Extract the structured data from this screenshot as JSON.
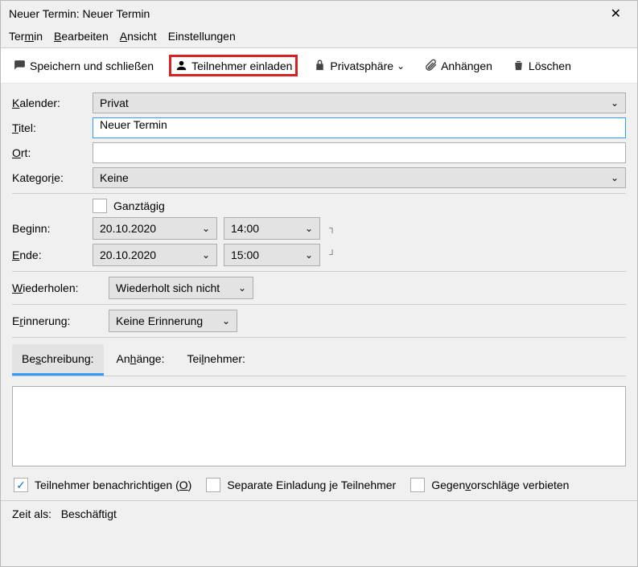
{
  "window": {
    "title": "Neuer Termin: Neuer Termin"
  },
  "menu": {
    "termin": "Termin",
    "bearbeiten": "Bearbeiten",
    "ansicht": "Ansicht",
    "einstellungen": "Einstellungen"
  },
  "toolbar": {
    "save_close": "Speichern und schließen",
    "invite": "Teilnehmer einladen",
    "privacy": "Privatsphäre",
    "attach": "Anhängen",
    "delete": "Löschen"
  },
  "labels": {
    "calendar": "Kalender:",
    "title": "Titel:",
    "location": "Ort:",
    "category": "Kategorie:",
    "allday": "Ganztägig",
    "start": "Beginn:",
    "end": "Ende:",
    "repeat": "Wiederholen:",
    "reminder": "Erinnerung:"
  },
  "values": {
    "calendar": "Privat",
    "title": "Neuer Termin",
    "location": "",
    "category": "Keine",
    "start_date": "20.10.2020",
    "start_time": "14:00",
    "end_date": "20.10.2020",
    "end_time": "15:00",
    "repeat": "Wiederholt sich nicht",
    "reminder": "Keine Erinnerung"
  },
  "tabs": {
    "description": "Beschreibung:",
    "attachments": "Anhänge:",
    "attendees": "Teilnehmer:"
  },
  "bottom": {
    "notify": "Teilnehmer benachrichtigen (O)",
    "separate": "Separate Einladung je Teilnehmer",
    "counter": "Gegenvorschläge verbieten"
  },
  "status": {
    "label": "Zeit als:",
    "value": "Beschäftigt"
  }
}
